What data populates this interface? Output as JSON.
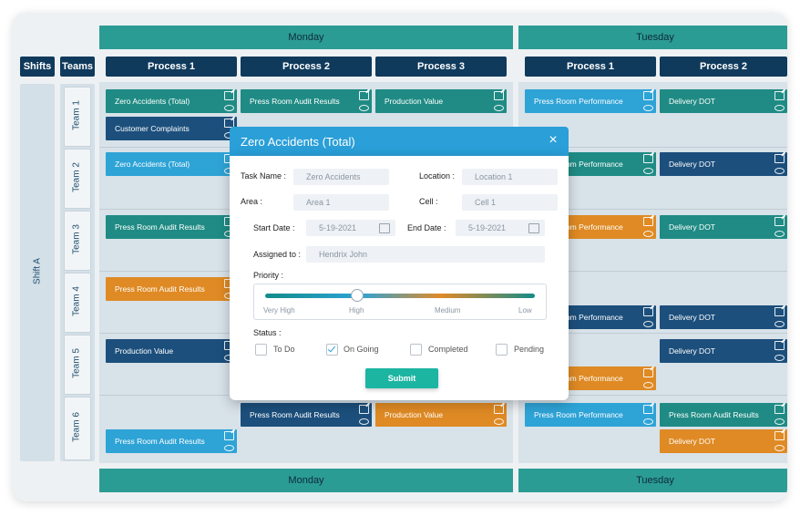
{
  "headers": {
    "shifts": "Shifts",
    "teams": "Teams",
    "days": [
      "Monday",
      "Tuesday"
    ],
    "monday_processes": [
      "Process 1",
      "Process 2",
      "Process 3"
    ],
    "tuesday_processes": [
      "Process 1",
      "Process 2"
    ]
  },
  "shift": "Shift A",
  "teams": [
    "Team 1",
    "Team 2",
    "Team 3",
    "Team 4",
    "Team 5",
    "Team 6"
  ],
  "cards": {
    "m1_r1": "Zero Accidents (Total)",
    "m1_r1b": "Customer Complaints",
    "m1_r2": "Zero Accidents (Total)",
    "m1_r3": "Press Room Audit Results",
    "m1_r4": "Press Room Audit Results",
    "m1_r5": "Production Value",
    "m1_r6": "Press Room Audit Results",
    "m2_r1": "Press Room Audit Results",
    "m2_r6": "Press Room Audit Results",
    "m3_r1": "Production Value",
    "m3_r6": "Production Value",
    "t1_r1": "Press Room Performance",
    "t1_r2": "Press Room Performance",
    "t1_r3": "Press Room Performance",
    "t1_r4": "Press Room Performance",
    "t1_r5": "Press Room Performance",
    "t1_r6": "Press Room Performance",
    "t2_r1": "Delivery DOT",
    "t2_r2": "Delivery DOT",
    "t2_r3": "Delivery DOT",
    "t2_r4": "Delivery DOT",
    "t2_r5": "Delivery DOT",
    "t2_r6a": "Press Room Audit Results",
    "t2_r6b": "Delivery DOT"
  },
  "modal": {
    "title": "Zero Accidents (Total)",
    "close": "×",
    "task_name_label": "Task Name :",
    "task_name_value": "Zero Accidents",
    "location_label": "Location :",
    "location_value": "Location 1",
    "area_label": "Area :",
    "area_value": "Area 1",
    "cell_label": "Cell :",
    "cell_value": "Cell 1",
    "start_label": "Start Date :",
    "start_value": "5-19-2021",
    "end_label": "End Date :",
    "end_value": "5-19-2021",
    "assigned_label": "Assigned to :",
    "assigned_value": "Hendrix John",
    "priority_label": "Priority :",
    "priority_ticks": [
      "Very High",
      "High",
      "Medium",
      "Low"
    ],
    "priority_selected": "High",
    "status_label": "Status :",
    "status_options": [
      "To Do",
      "On Going",
      "Completed",
      "Pending"
    ],
    "status_selected": "On Going",
    "submit": "Submit"
  },
  "colors": {
    "teal": "#1f8b84",
    "navy": "#1c4f7c",
    "blue": "#2ea3d6",
    "orange": "#df8a24",
    "header_teal": "#2b9c94",
    "dark_navy": "#0f3a5c"
  }
}
